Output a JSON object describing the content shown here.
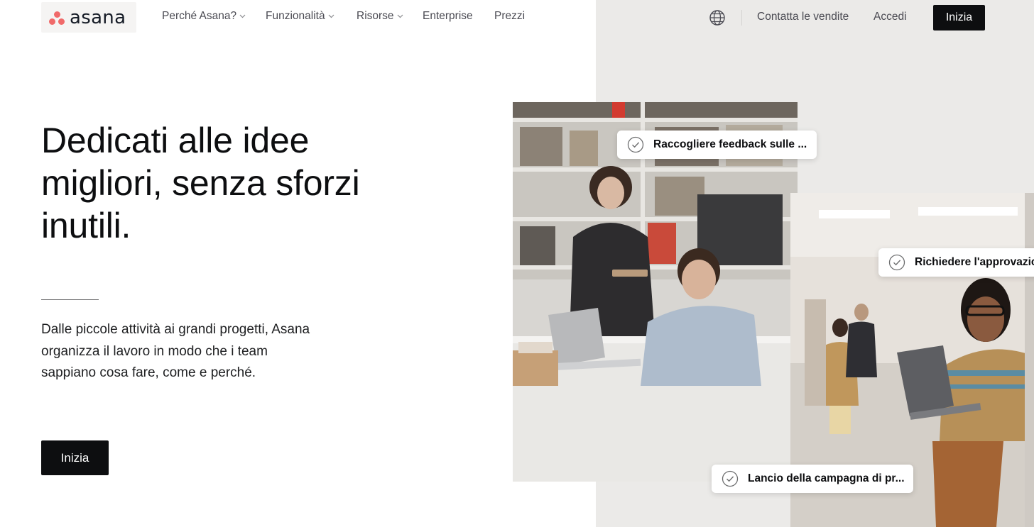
{
  "header": {
    "logo_text": "asana",
    "nav": [
      {
        "label": "Perché Asana?",
        "has_dropdown": true
      },
      {
        "label": "Funzionalità",
        "has_dropdown": true
      },
      {
        "label": "Risorse",
        "has_dropdown": true
      },
      {
        "label": "Enterprise",
        "has_dropdown": false
      },
      {
        "label": "Prezzi",
        "has_dropdown": false
      }
    ],
    "language_icon": "globe-icon",
    "contact_sales": "Contatta le vendite",
    "login": "Accedi",
    "cta": "Inizia"
  },
  "hero": {
    "title_lines": [
      "Dedicati alle idee",
      "migliori, senza sforzi",
      "inutili."
    ],
    "description_lines": [
      "Dalle piccole attività ai grandi progetti, Asana",
      "organizza il lavoro in modo che i team",
      "sappiano cosa fare, come e perché."
    ],
    "cta": "Inizia"
  },
  "task_cards": [
    {
      "label": "Raccogliere feedback sulle ...",
      "icon": "check-circle-icon"
    },
    {
      "label": "Richiedere l'approvazio",
      "icon": "check-circle-icon"
    },
    {
      "label": "Lancio della campagna di pr...",
      "icon": "check-circle-icon"
    }
  ],
  "colors": {
    "brand_coral": "#f06a6a",
    "button_dark": "#0d0e10",
    "panel_grey": "#ebeae8",
    "text_primary": "#0d0e10",
    "nav_text": "#4a4a52"
  }
}
